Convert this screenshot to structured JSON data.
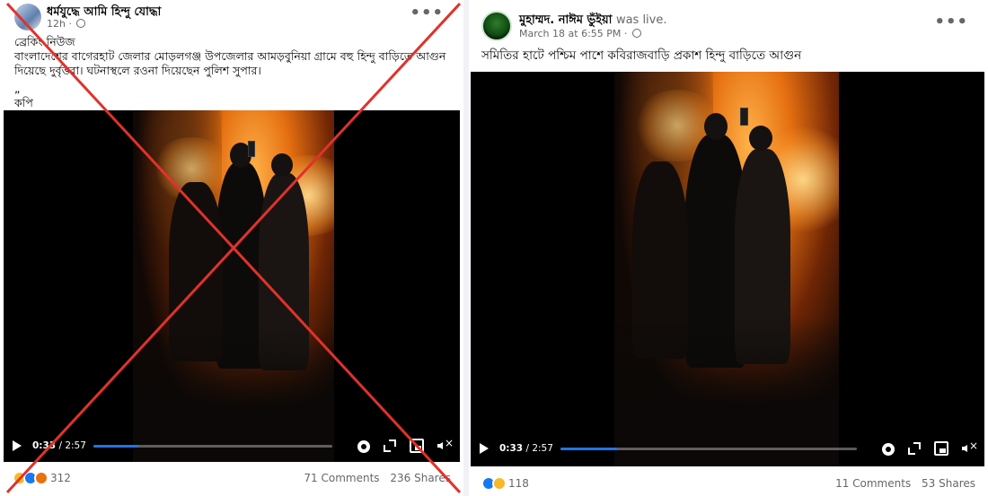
{
  "left_post": {
    "author": "ধর্মযুদ্ধে আমি হিন্দু যোদ্ধা",
    "time": "12h",
    "more_label": "•••",
    "text_lines": [
      "ব্রেকিং নিউজ",
      "বাংলাদেশের বাগেরহাট জেলার মোড়লগঞ্জ উপজেলার আমড়বুনিয়া গ্রামে বহু হিন্দু বাড়িতে আগুন",
      "দিয়েছে দুর্বৃত্তরা। ঘটনাস্থলে রওনা দিয়েছেন পুলিশ সুপার।",
      "„",
      "কপি"
    ],
    "video": {
      "current": "0:33",
      "duration": "2:57",
      "progress": 0.19
    },
    "reaction_count": "312",
    "comments": "71 Comments",
    "shares": "236 Shares",
    "reactions": [
      "like",
      "haha",
      "angry"
    ],
    "crossed_out": true,
    "cross_color": "#e0322b"
  },
  "right_post": {
    "author": "মুহাম্মদ. নাঈম ভুঁইয়া",
    "author_suffix": "was live.",
    "time": "March 18 at 6:55 PM",
    "more_label": "•••",
    "text": "সমিতির হাটে পশ্চিম পাশে কবিরাজবাড়ি প্রকাশ হিন্দু বাড়িতে আগুন",
    "video": {
      "current": "0:33",
      "duration": "2:57",
      "progress": 0.19
    },
    "reaction_count": "118",
    "comments": "11 Comments",
    "shares": "53 Shares",
    "reactions": [
      "like",
      "sad"
    ]
  },
  "colors": {
    "accent": "#2374e1",
    "muted_text": "#65676b"
  }
}
